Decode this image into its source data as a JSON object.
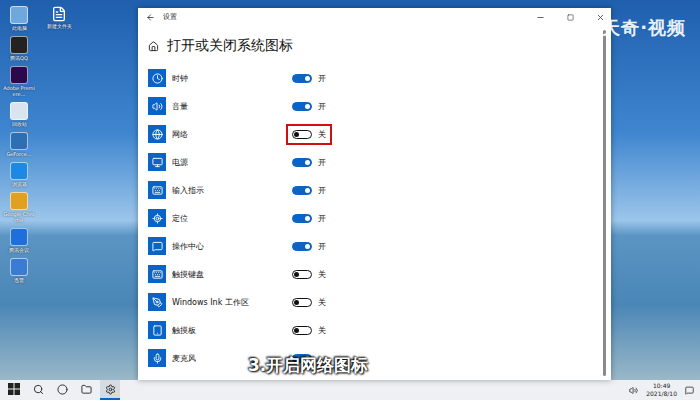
{
  "window": {
    "title": "设置",
    "heading": "打开或关闭系统图标"
  },
  "toggles": [
    {
      "label": "时钟",
      "on": true,
      "state_text": "开",
      "highlighted": false
    },
    {
      "label": "音量",
      "on": true,
      "state_text": "开",
      "highlighted": false
    },
    {
      "label": "网络",
      "on": false,
      "state_text": "关",
      "highlighted": true
    },
    {
      "label": "电源",
      "on": true,
      "state_text": "开",
      "highlighted": false
    },
    {
      "label": "输入指示",
      "on": true,
      "state_text": "开",
      "highlighted": false
    },
    {
      "label": "定位",
      "on": true,
      "state_text": "开",
      "highlighted": false
    },
    {
      "label": "操作中心",
      "on": true,
      "state_text": "开",
      "highlighted": false
    },
    {
      "label": "触摸键盘",
      "on": false,
      "state_text": "关",
      "highlighted": false
    },
    {
      "label": "Windows Ink 工作区",
      "on": false,
      "state_text": "关",
      "highlighted": false
    },
    {
      "label": "触摸板",
      "on": false,
      "state_text": "关",
      "highlighted": false
    },
    {
      "label": "麦克风",
      "on": true,
      "state_text": "",
      "highlighted": false
    }
  ],
  "desktop_icons": [
    {
      "label": "此电脑",
      "color": "#6fa8dc"
    },
    {
      "label": "腾讯QQ",
      "color": "#222222"
    },
    {
      "label": "Adobe Premiere...",
      "color": "#2a0a4a"
    },
    {
      "label": "回收站",
      "color": "#d9e4ee"
    },
    {
      "label": "GeForce...",
      "color": "#2d6fb5"
    },
    {
      "label": "浏览器",
      "color": "#1e88e5"
    },
    {
      "label": "Google Chrome",
      "color": "#e0a020"
    },
    {
      "label": "腾讯会议",
      "color": "#1e6fd9"
    },
    {
      "label": "迅雷",
      "color": "#3a7bd5"
    }
  ],
  "desktop_icons_second": [
    {
      "label": "新建文件夹"
    }
  ],
  "watermark": "天奇·视频",
  "caption": "3.开启网络图标",
  "taskbar": {
    "time": "10:49",
    "date": "2021/8/10"
  }
}
